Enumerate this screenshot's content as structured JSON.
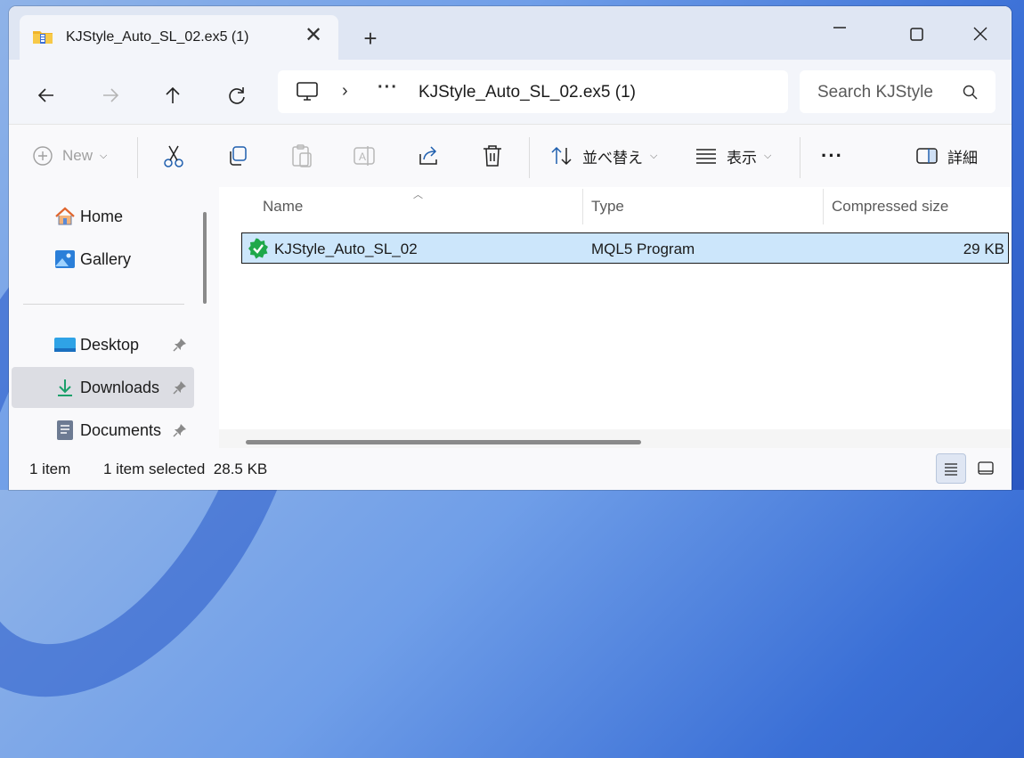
{
  "window": {
    "tab_title": "KJStyle_Auto_SL_02.ex5 (1)",
    "tab_close": "✕",
    "new_tab": "+"
  },
  "address": {
    "path": "KJStyle_Auto_SL_02.ex5 (1)",
    "chevron": "›",
    "ellipsis": "···"
  },
  "search": {
    "placeholder": "Search KJStyle"
  },
  "commands": {
    "new": "New",
    "sort": "並べ替え",
    "view": "表示",
    "more": "···",
    "details": "詳細"
  },
  "sidebar": {
    "items": [
      {
        "label": "Home",
        "icon": "home-icon"
      },
      {
        "label": "Gallery",
        "icon": "gallery-icon"
      },
      {
        "label": "Desktop",
        "icon": "desktop-icon",
        "pinned": true
      },
      {
        "label": "Downloads",
        "icon": "downloads-icon",
        "pinned": true,
        "selected": true
      },
      {
        "label": "Documents",
        "icon": "documents-icon",
        "pinned": true
      }
    ]
  },
  "columns": [
    "Name",
    "Type",
    "Compressed size"
  ],
  "files": [
    {
      "name": "KJStyle_Auto_SL_02",
      "type": "MQL5 Program",
      "size": "29 KB",
      "selected": true
    }
  ],
  "status": {
    "count": "1 item",
    "selected": "1 item selected  28.5 KB"
  },
  "colors": {
    "accent": "#0067c0",
    "selection": "#cce6fb",
    "file_icon": "#16a34a"
  }
}
